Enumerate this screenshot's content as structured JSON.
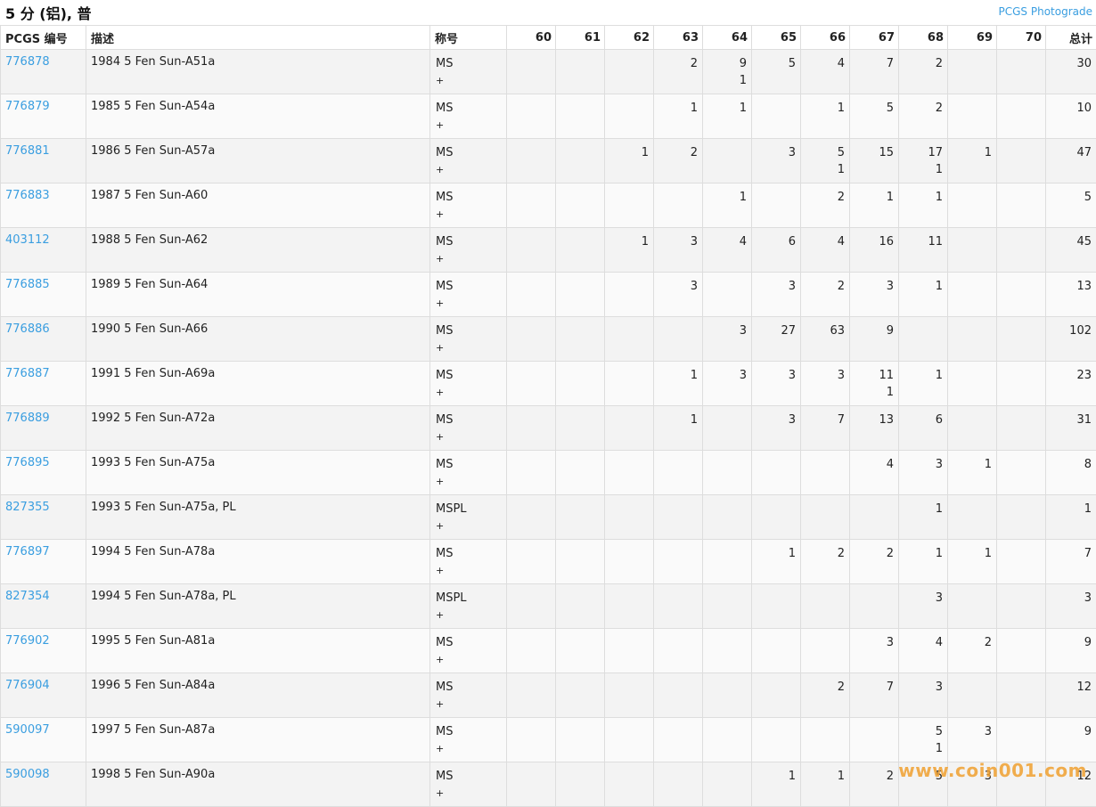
{
  "header": {
    "title": "5 分 (铝), 普",
    "photograde_link": "PCGS Photograde"
  },
  "columns": {
    "pcgs_no": "PCGS 编号",
    "description": "描述",
    "designation": "称号",
    "grades": [
      "60",
      "61",
      "62",
      "63",
      "64",
      "65",
      "66",
      "67",
      "68",
      "69",
      "70"
    ],
    "total": "总计"
  },
  "rows": [
    {
      "id": "776878",
      "desc": "1984 5 Fen Sun-A51a",
      "des": "MS",
      "plus": "+",
      "grades": [
        "",
        "",
        "",
        "2",
        "9\n1",
        "5",
        "4",
        "7",
        "2",
        "",
        ""
      ],
      "total": "30"
    },
    {
      "id": "776879",
      "desc": "1985 5 Fen Sun-A54a",
      "des": "MS",
      "plus": "+",
      "grades": [
        "",
        "",
        "",
        "1",
        "1",
        "",
        "1",
        "5",
        "2",
        "",
        ""
      ],
      "total": "10"
    },
    {
      "id": "776881",
      "desc": "1986 5 Fen Sun-A57a",
      "des": "MS",
      "plus": "+",
      "grades": [
        "",
        "",
        "1",
        "2",
        "",
        "3",
        "5\n1",
        "15",
        "17\n1",
        "1",
        ""
      ],
      "total": "47"
    },
    {
      "id": "776883",
      "desc": "1987 5 Fen Sun-A60",
      "des": "MS",
      "plus": "+",
      "grades": [
        "",
        "",
        "",
        "",
        "1",
        "",
        "2",
        "1",
        "1",
        "",
        ""
      ],
      "total": "5"
    },
    {
      "id": "403112",
      "desc": "1988 5 Fen Sun-A62",
      "des": "MS",
      "plus": "+",
      "grades": [
        "",
        "",
        "1",
        "3",
        "4",
        "6",
        "4",
        "16",
        "11",
        "",
        ""
      ],
      "total": "45"
    },
    {
      "id": "776885",
      "desc": "1989 5 Fen Sun-A64",
      "des": "MS",
      "plus": "+",
      "grades": [
        "",
        "",
        "",
        "3",
        "",
        "3",
        "2",
        "3",
        "1",
        "",
        ""
      ],
      "total": "13"
    },
    {
      "id": "776886",
      "desc": "1990 5 Fen Sun-A66",
      "des": "MS",
      "plus": "+",
      "grades": [
        "",
        "",
        "",
        "",
        "3",
        "27",
        "63",
        "9",
        "",
        "",
        ""
      ],
      "total": "102"
    },
    {
      "id": "776887",
      "desc": "1991 5 Fen Sun-A69a",
      "des": "MS",
      "plus": "+",
      "grades": [
        "",
        "",
        "",
        "1",
        "3",
        "3",
        "3",
        "11\n1",
        "1",
        "",
        ""
      ],
      "total": "23"
    },
    {
      "id": "776889",
      "desc": "1992 5 Fen Sun-A72a",
      "des": "MS",
      "plus": "+",
      "grades": [
        "",
        "",
        "",
        "1",
        "",
        "3",
        "7",
        "13",
        "6",
        "",
        ""
      ],
      "total": "31"
    },
    {
      "id": "776895",
      "desc": "1993 5 Fen Sun-A75a",
      "des": "MS",
      "plus": "+",
      "grades": [
        "",
        "",
        "",
        "",
        "",
        "",
        "",
        "4",
        "3",
        "1",
        ""
      ],
      "total": "8"
    },
    {
      "id": "827355",
      "desc": "1993 5 Fen Sun-A75a, PL",
      "des": "MSPL",
      "plus": "+",
      "grades": [
        "",
        "",
        "",
        "",
        "",
        "",
        "",
        "",
        "1",
        "",
        ""
      ],
      "total": "1"
    },
    {
      "id": "776897",
      "desc": "1994 5 Fen Sun-A78a",
      "des": "MS",
      "plus": "+",
      "grades": [
        "",
        "",
        "",
        "",
        "",
        "1",
        "2",
        "2",
        "1",
        "1",
        ""
      ],
      "total": "7"
    },
    {
      "id": "827354",
      "desc": "1994 5 Fen Sun-A78a, PL",
      "des": "MSPL",
      "plus": "+",
      "grades": [
        "",
        "",
        "",
        "",
        "",
        "",
        "",
        "",
        "3",
        "",
        ""
      ],
      "total": "3"
    },
    {
      "id": "776902",
      "desc": "1995 5 Fen Sun-A81a",
      "des": "MS",
      "plus": "+",
      "grades": [
        "",
        "",
        "",
        "",
        "",
        "",
        "",
        "3",
        "4",
        "2",
        ""
      ],
      "total": "9"
    },
    {
      "id": "776904",
      "desc": "1996 5 Fen Sun-A84a",
      "des": "MS",
      "plus": "+",
      "grades": [
        "",
        "",
        "",
        "",
        "",
        "",
        "2",
        "7",
        "3",
        "",
        ""
      ],
      "total": "12"
    },
    {
      "id": "590097",
      "desc": "1997 5 Fen Sun-A87a",
      "des": "MS",
      "plus": "+",
      "grades": [
        "",
        "",
        "",
        "",
        "",
        "",
        "",
        "",
        "5\n1",
        "3",
        ""
      ],
      "total": "9"
    },
    {
      "id": "590098",
      "desc": "1998 5 Fen Sun-A90a",
      "des": "MS",
      "plus": "+",
      "grades": [
        "",
        "",
        "",
        "",
        "",
        "1",
        "1",
        "2",
        "5",
        "3",
        ""
      ],
      "total": "12"
    }
  ],
  "watermark": "www.coin001.com",
  "colors": {
    "link": "#3a9ee0",
    "watermark": "#f0a030"
  }
}
